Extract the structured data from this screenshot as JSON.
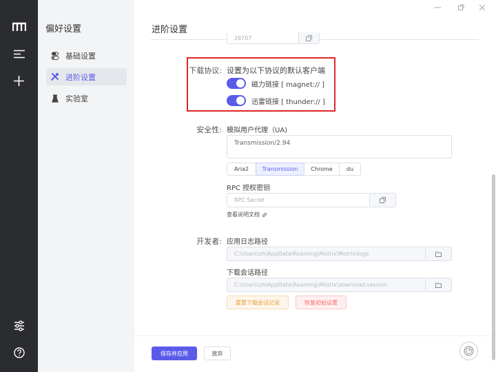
{
  "sidebar": {
    "title": "偏好设置",
    "items": [
      {
        "label": "基础设置"
      },
      {
        "label": "进阶设置"
      },
      {
        "label": "实验室"
      }
    ]
  },
  "main": {
    "title": "进阶设置",
    "top_field_value": "26707"
  },
  "download_protocol": {
    "label": "下载协议:",
    "description": "设置为以下协议的默认客户端",
    "magnet": {
      "label": "磁力链接 [ magnet:// ]",
      "checked": true
    },
    "thunder": {
      "label": "迅雷链接 [ thunder:// ]",
      "checked": true
    }
  },
  "security": {
    "label": "安全性:",
    "ua_label": "模拟用户代理（UA)",
    "ua_value": "Transmission/2.94",
    "ua_presets": [
      "Aria2",
      "Transmission",
      "Chrome",
      "du"
    ],
    "ua_selected": "Transmission",
    "rpc_label": "RPC 授权密钥",
    "rpc_placeholder": "RPC Secret",
    "docs_link": "查看说明文档"
  },
  "developer": {
    "label": "开发者:",
    "log_label": "应用日志路径",
    "log_path": "C:\\Users\\zh\\AppData\\Roaming\\Motrix\\Motrix\\logs",
    "session_label": "下载会话路径",
    "session_path": "C:\\Users\\zh\\AppData\\Roaming\\Motrix\\download.session",
    "reset_session": "重置下载会话记录",
    "factory_reset": "恢复初始设置"
  },
  "footer": {
    "save": "保存并应用",
    "discard": "放弃"
  },
  "colors": {
    "accent": "#5b5bea",
    "rail": "#2b2c30",
    "highlight_box": "#e02525"
  },
  "icons": {
    "rail": [
      "motrix-logo-icon",
      "menu-lines-icon",
      "plus-icon",
      "sliders-icon",
      "help-icon"
    ],
    "window": [
      "minimize-icon",
      "restore-icon",
      "close-icon"
    ]
  }
}
